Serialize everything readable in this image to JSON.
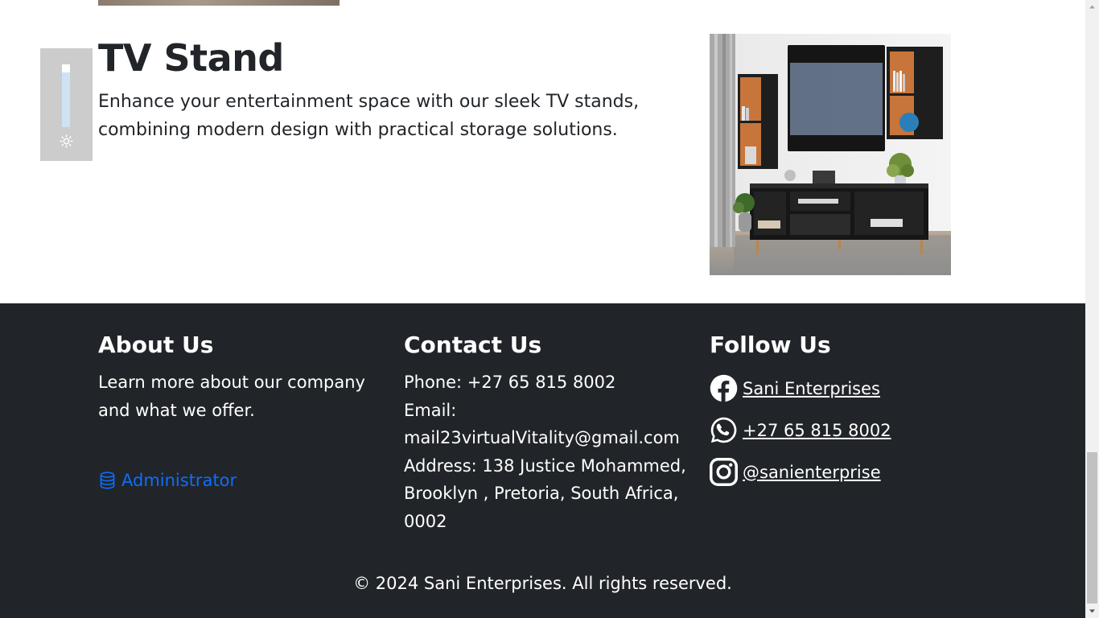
{
  "product": {
    "title": "TV Stand",
    "description": "Enhance your entertainment space with our sleek TV stands, combining modern design with practical storage solutions.",
    "image_icon": "tv-stand-photo"
  },
  "brightness": {
    "level_percent": 87,
    "icon": "sun-icon"
  },
  "footer": {
    "about": {
      "heading": "About Us",
      "text": "Learn more about our company and what we offer.",
      "admin_label": "Administrator",
      "admin_icon": "database-icon"
    },
    "contact": {
      "heading": "Contact Us",
      "phone": "Phone: +27 65 815 8002",
      "email_label": "Email:",
      "email": "mail23virtualVitality@gmail.com",
      "address": "Address: 138 Justice Mohammed, Brooklyn , Pretoria, South Africa, 0002"
    },
    "follow": {
      "heading": "Follow Us",
      "facebook": "Sani Enterprises",
      "whatsapp": "+27 65 815 8002",
      "instagram": "@sanienterprise"
    },
    "copyright": "© 2024 Sani Enterprises. All rights reserved."
  },
  "colors": {
    "footer_bg": "#212529",
    "link": "#0d6efd",
    "widget_bg": "#cccccc",
    "slider_fill": "#cfe2f3"
  }
}
